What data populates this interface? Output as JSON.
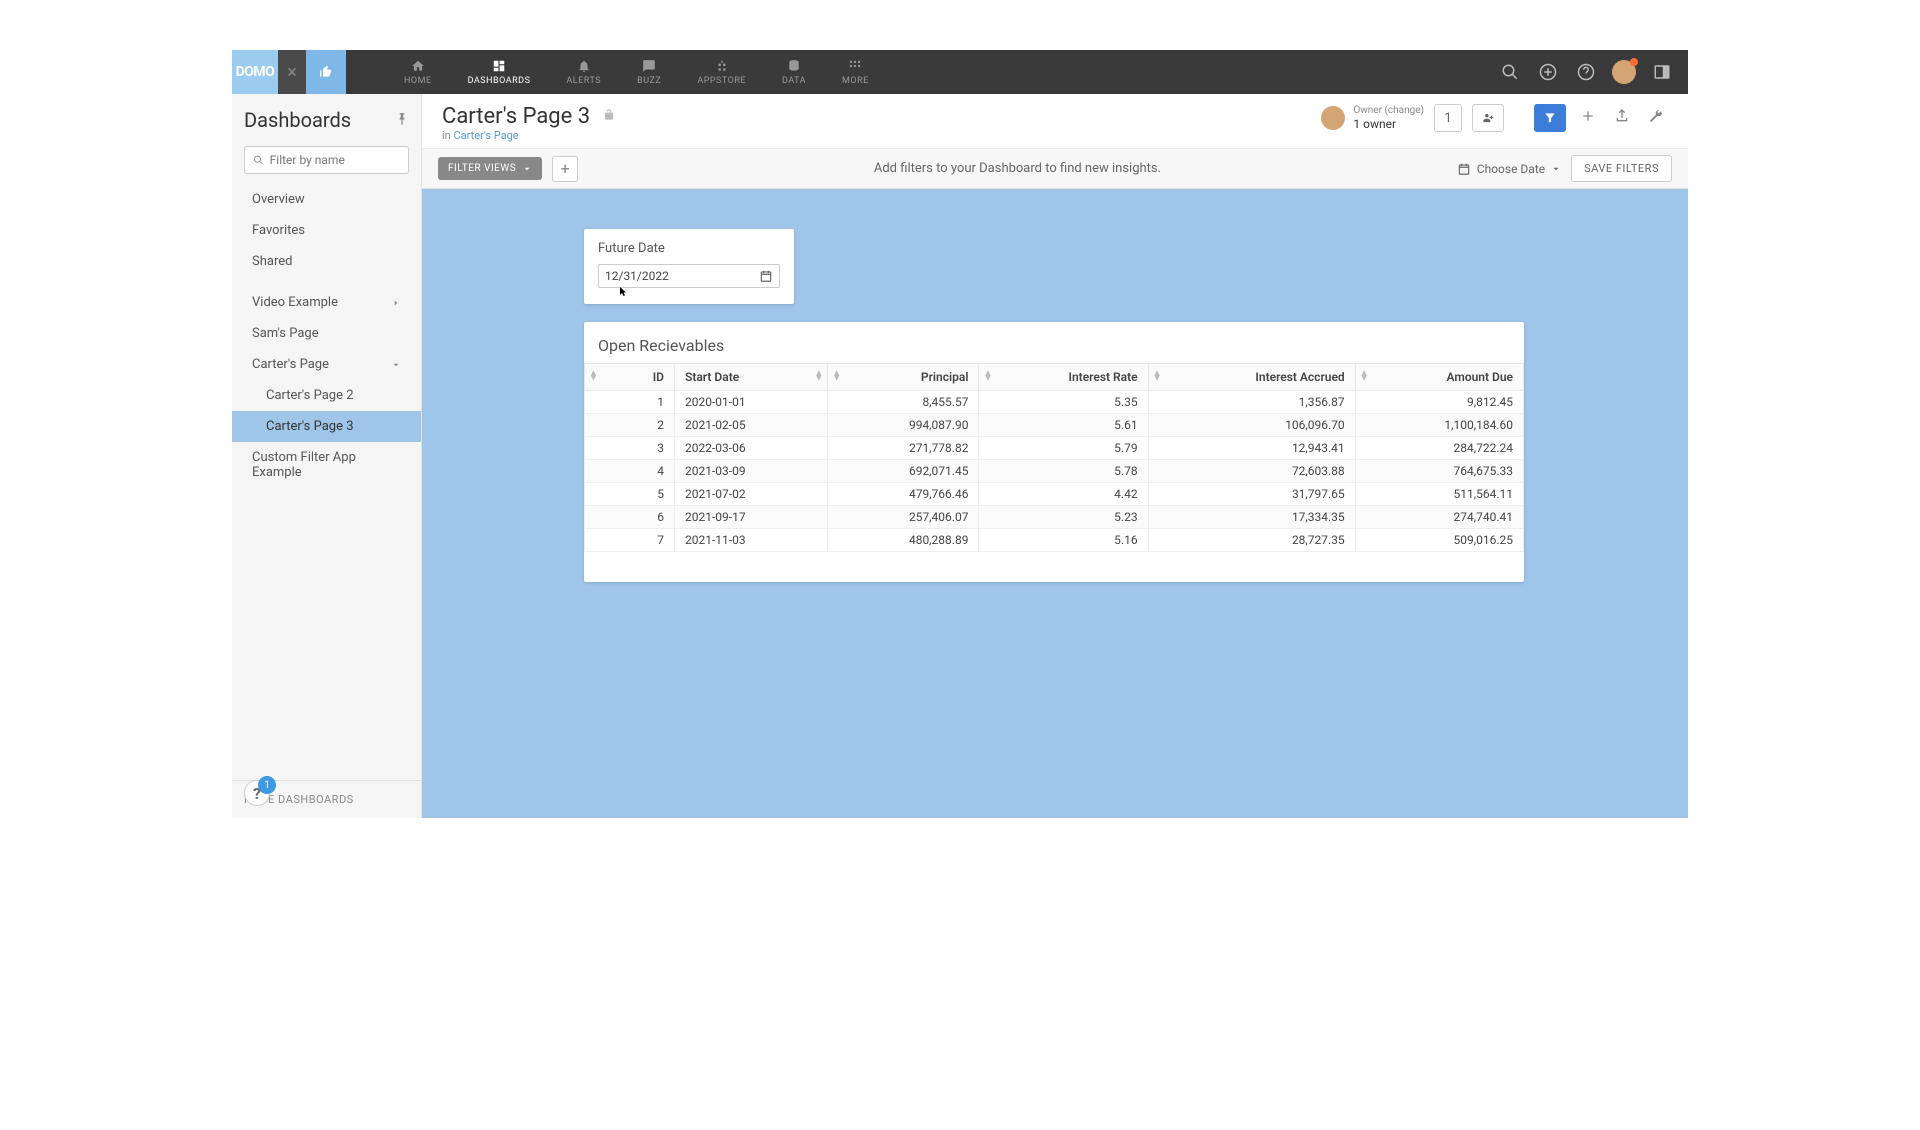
{
  "brand": "DOMO",
  "portal_label": "",
  "nav": {
    "items": [
      {
        "label": "HOME"
      },
      {
        "label": "DASHBOARDS"
      },
      {
        "label": "ALERTS"
      },
      {
        "label": "BUZZ"
      },
      {
        "label": "APPSTORE"
      },
      {
        "label": "DATA"
      },
      {
        "label": "MORE"
      }
    ]
  },
  "sidebar": {
    "title": "Dashboards",
    "filter_placeholder": "Filter by name",
    "items": [
      {
        "label": "Overview"
      },
      {
        "label": "Favorites"
      },
      {
        "label": "Shared"
      }
    ],
    "items2": [
      {
        "label": "Video Example"
      },
      {
        "label": "Sam's Page"
      },
      {
        "label": "Carter's Page"
      },
      {
        "label": "Carter's Page 2"
      },
      {
        "label": "Carter's Page 3"
      },
      {
        "label": "Custom Filter App Example"
      }
    ],
    "footer": "NAGE DASHBOARDS",
    "help_count": "1"
  },
  "page": {
    "title": "Carter's Page 3",
    "breadcrumb_prefix": "in ",
    "breadcrumb_link": "Carter's Page",
    "owner_label": "Owner (change)",
    "owner_count": "1 owner",
    "share_count": "1"
  },
  "filterbar": {
    "views_label": "FILTER VIEWS",
    "hint": "Add filters to your Dashboard to find new insights.",
    "choose_date": "Choose Date",
    "save": "SAVE FILTERS"
  },
  "date_card": {
    "title": "Future Date",
    "value": "12/31/2022"
  },
  "table": {
    "title": "Open Recievables",
    "columns": [
      "ID",
      "Start Date",
      "Principal",
      "Interest Rate",
      "Interest Accrued",
      "Amount Due"
    ],
    "rows": [
      {
        "id": "1",
        "start": "2020-01-01",
        "principal": "8,455.57",
        "rate": "5.35",
        "accrued": "1,356.87",
        "due": "9,812.45"
      },
      {
        "id": "2",
        "start": "2021-02-05",
        "principal": "994,087.90",
        "rate": "5.61",
        "accrued": "106,096.70",
        "due": "1,100,184.60"
      },
      {
        "id": "3",
        "start": "2022-03-06",
        "principal": "271,778.82",
        "rate": "5.79",
        "accrued": "12,943.41",
        "due": "284,722.24"
      },
      {
        "id": "4",
        "start": "2021-03-09",
        "principal": "692,071.45",
        "rate": "5.78",
        "accrued": "72,603.88",
        "due": "764,675.33"
      },
      {
        "id": "5",
        "start": "2021-07-02",
        "principal": "479,766.46",
        "rate": "4.42",
        "accrued": "31,797.65",
        "due": "511,564.11"
      },
      {
        "id": "6",
        "start": "2021-09-17",
        "principal": "257,406.07",
        "rate": "5.23",
        "accrued": "17,334.35",
        "due": "274,740.41"
      },
      {
        "id": "7",
        "start": "2021-11-03",
        "principal": "480,288.89",
        "rate": "5.16",
        "accrued": "28,727.35",
        "due": "509,016.25"
      }
    ]
  }
}
